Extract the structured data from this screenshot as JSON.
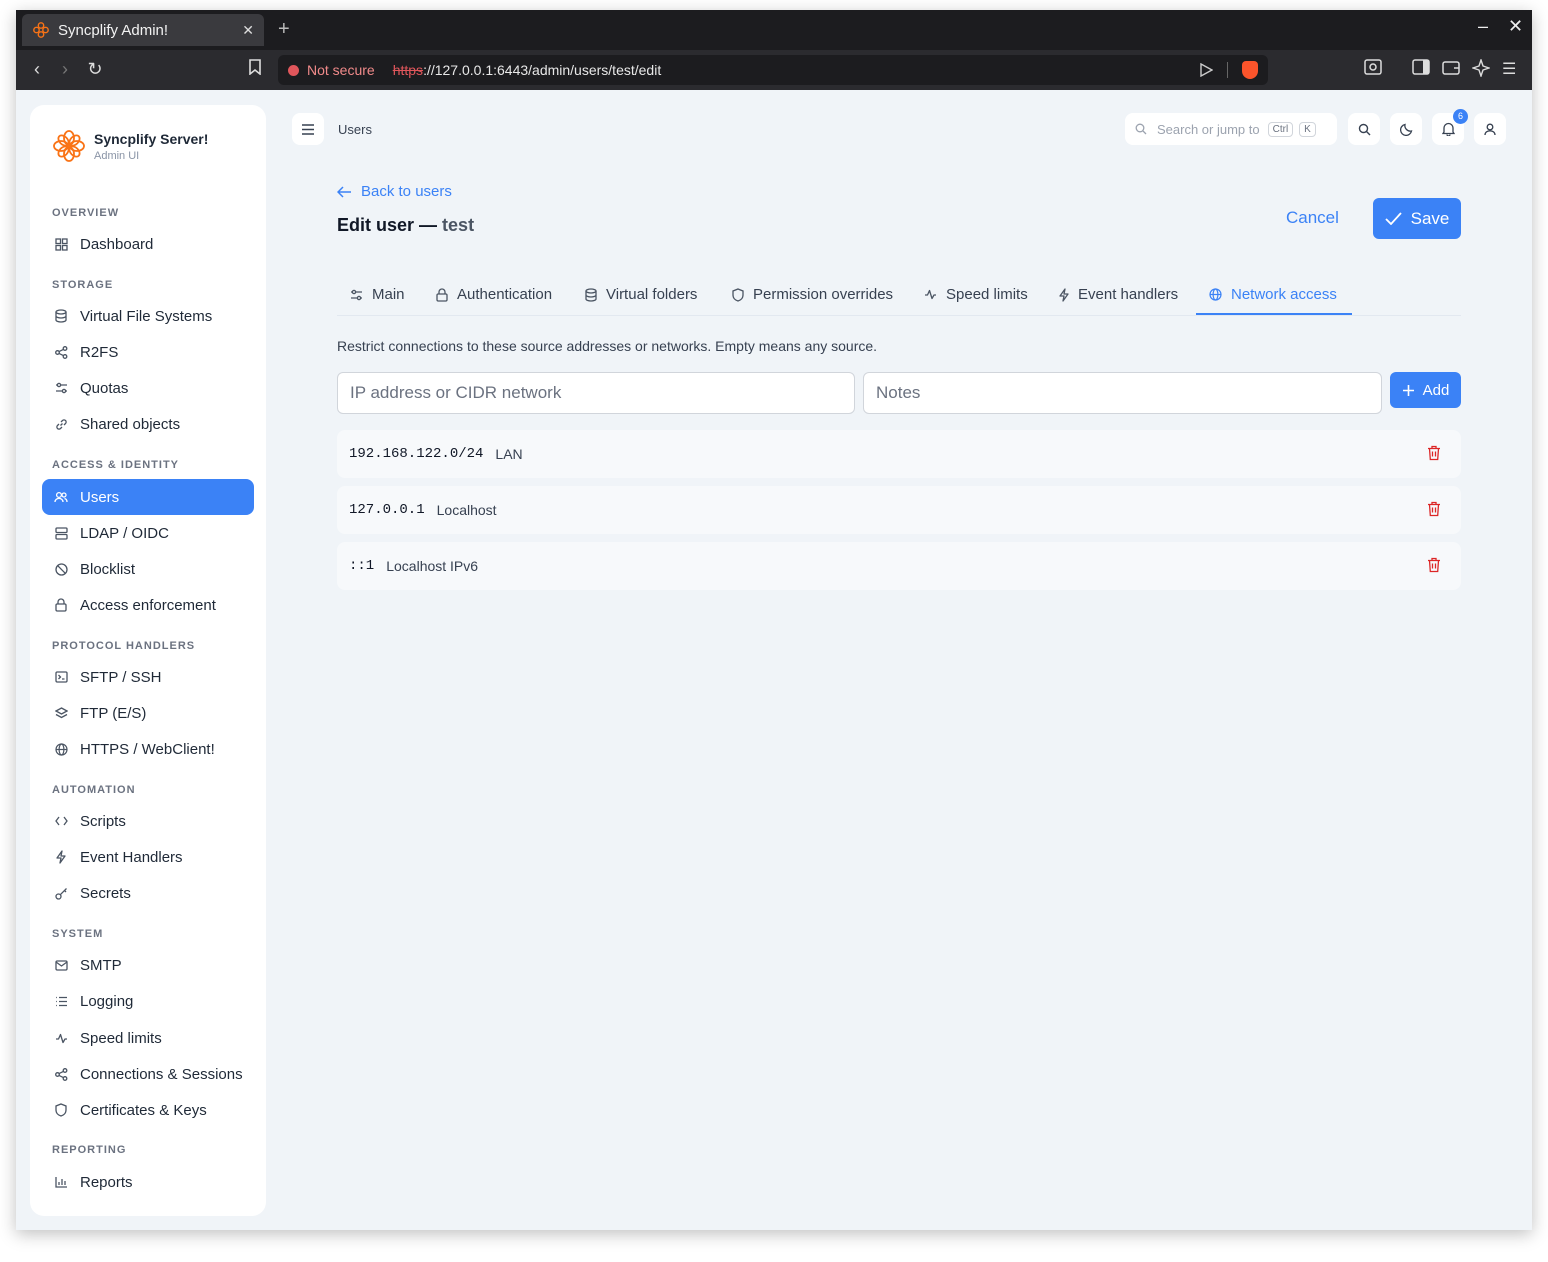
{
  "browser": {
    "tab_title": "Syncplify Admin!",
    "not_secure": "Not secure",
    "url_scheme": "https",
    "url_rest": "://127.0.0.1:6443/admin/users/test/edit"
  },
  "brand": {
    "title": "Syncplify Server!",
    "subtitle": "Admin UI",
    "accent": "#f97316"
  },
  "sidebar": {
    "sections": [
      {
        "label": "OVERVIEW",
        "items": [
          {
            "label": "Dashboard",
            "icon": "grid-icon"
          }
        ]
      },
      {
        "label": "STORAGE",
        "items": [
          {
            "label": "Virtual File Systems",
            "icon": "database-icon"
          },
          {
            "label": "R2FS",
            "icon": "share-icon"
          },
          {
            "label": "Quotas",
            "icon": "sliders-icon"
          },
          {
            "label": "Shared objects",
            "icon": "link-icon"
          }
        ]
      },
      {
        "label": "ACCESS & IDENTITY",
        "items": [
          {
            "label": "Users",
            "icon": "users-icon",
            "active": true
          },
          {
            "label": "LDAP / OIDC",
            "icon": "server-icon"
          },
          {
            "label": "Blocklist",
            "icon": "ban-icon"
          },
          {
            "label": "Access enforcement",
            "icon": "lock-icon"
          }
        ]
      },
      {
        "label": "PROTOCOL HANDLERS",
        "items": [
          {
            "label": "SFTP / SSH",
            "icon": "terminal-icon"
          },
          {
            "label": "FTP (E/S)",
            "icon": "layers-icon"
          },
          {
            "label": "HTTPS / WebClient!",
            "icon": "globe-icon"
          }
        ]
      },
      {
        "label": "AUTOMATION",
        "items": [
          {
            "label": "Scripts",
            "icon": "code-icon"
          },
          {
            "label": "Event Handlers",
            "icon": "bolt-icon"
          },
          {
            "label": "Secrets",
            "icon": "key-icon"
          }
        ]
      },
      {
        "label": "SYSTEM",
        "items": [
          {
            "label": "SMTP",
            "icon": "mail-icon"
          },
          {
            "label": "Logging",
            "icon": "list-icon"
          },
          {
            "label": "Speed limits",
            "icon": "activity-icon"
          },
          {
            "label": "Connections & Sessions",
            "icon": "share-icon"
          },
          {
            "label": "Certificates & Keys",
            "icon": "shield-icon"
          }
        ]
      },
      {
        "label": "REPORTING",
        "items": [
          {
            "label": "Reports",
            "icon": "chart-icon"
          }
        ]
      }
    ]
  },
  "header": {
    "breadcrumb": "Users",
    "search_placeholder": "Search or jump to",
    "kbd_ctrl": "Ctrl",
    "kbd_k": "K",
    "notifications": "6"
  },
  "page": {
    "back_label": "Back to users",
    "title_prefix": "Edit user —",
    "title_user": "test",
    "cancel_label": "Cancel",
    "save_label": "Save",
    "tabs": [
      {
        "label": "Main",
        "icon": "sliders-icon"
      },
      {
        "label": "Authentication",
        "icon": "lock-icon"
      },
      {
        "label": "Virtual folders",
        "icon": "database-icon"
      },
      {
        "label": "Permission overrides",
        "icon": "shield-icon"
      },
      {
        "label": "Speed limits",
        "icon": "activity-icon"
      },
      {
        "label": "Event handlers",
        "icon": "bolt-icon"
      },
      {
        "label": "Network access",
        "icon": "globe-icon",
        "active": true
      }
    ],
    "description": "Restrict connections to these source addresses or networks. Empty means any source.",
    "ip_placeholder": "IP address or CIDR network",
    "notes_placeholder": "Notes",
    "add_label": "Add",
    "entries": [
      {
        "address": "192.168.122.0/24",
        "note": "LAN"
      },
      {
        "address": "127.0.0.1",
        "note": "Localhost"
      },
      {
        "address": "::1",
        "note": "Localhost IPv6"
      }
    ]
  },
  "colors": {
    "primary": "#3b82f6",
    "danger": "#dc2626"
  }
}
